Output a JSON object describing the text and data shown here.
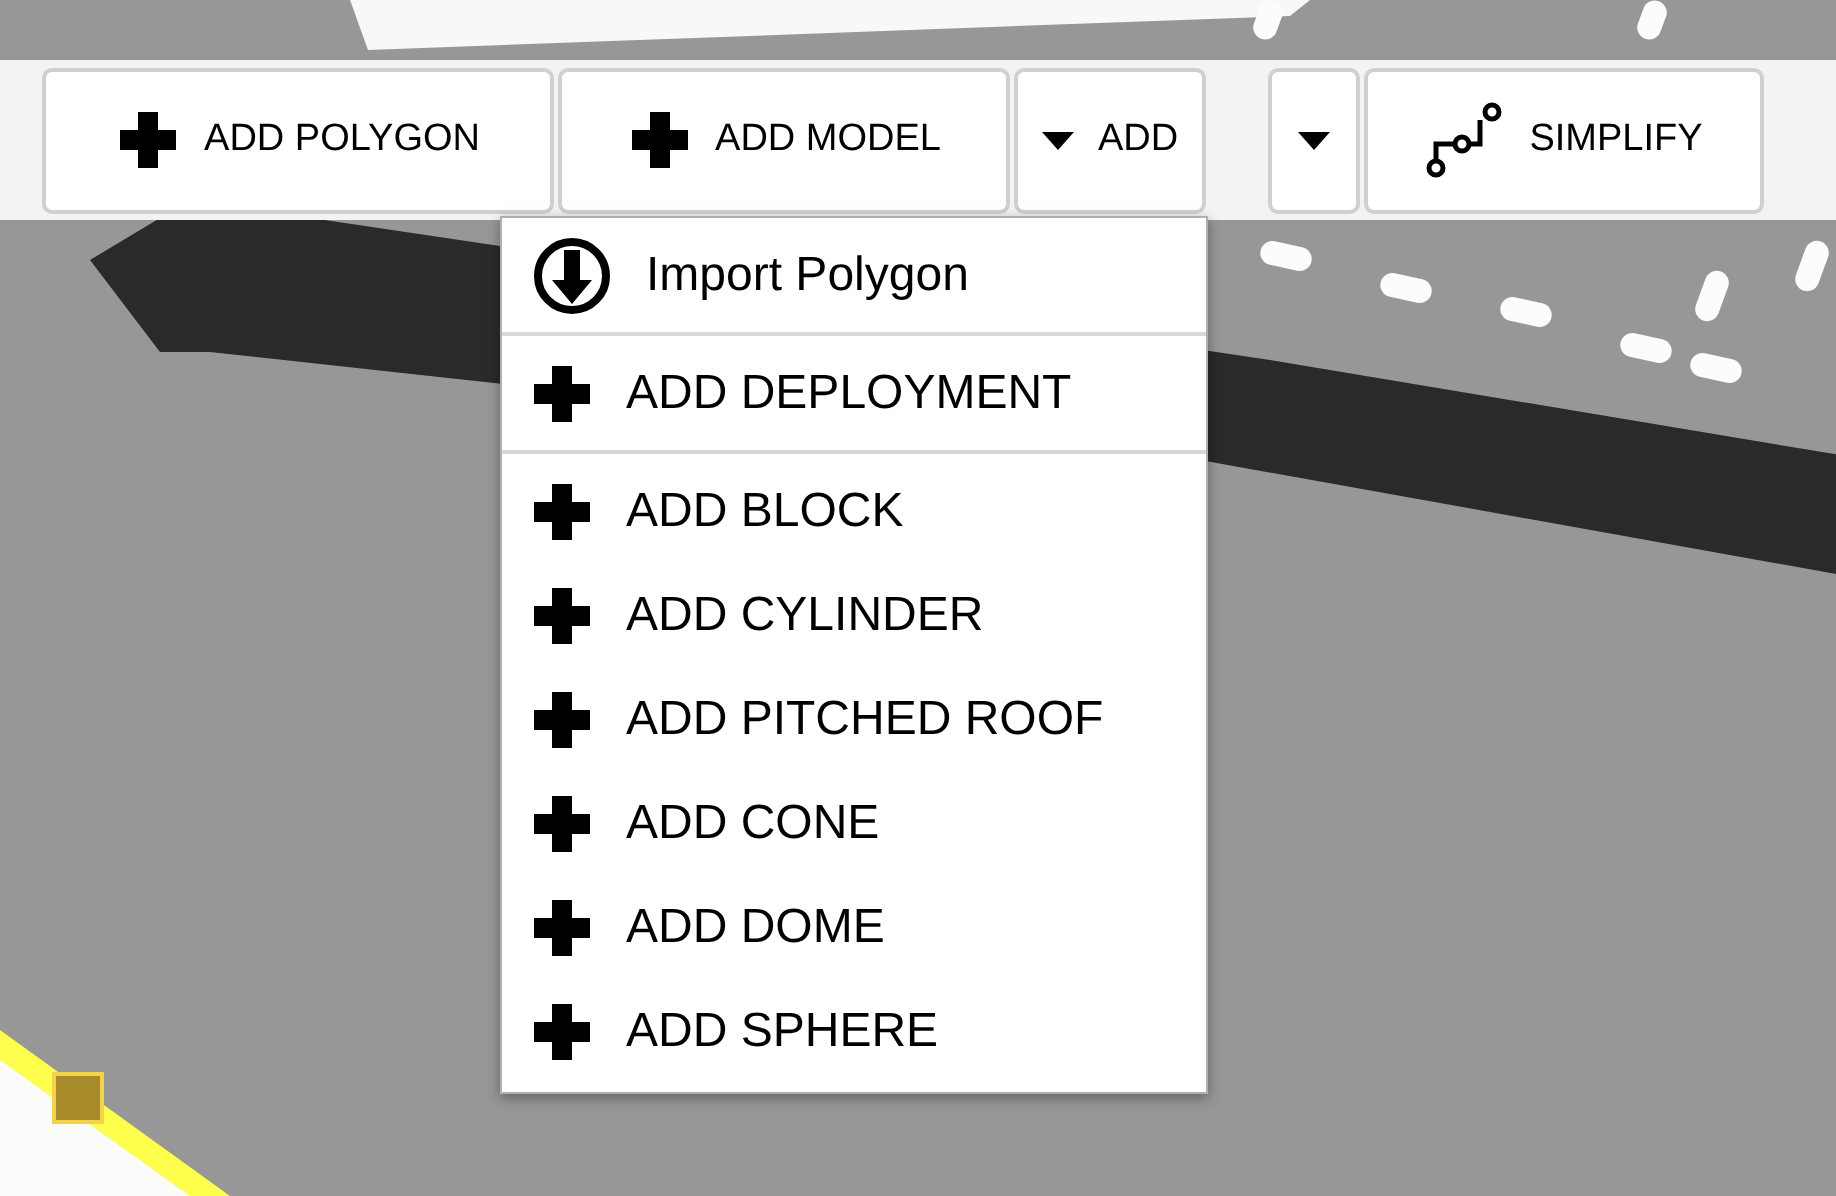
{
  "toolbar": {
    "buttons": [
      {
        "kind": "add",
        "label": "ADD POLYGON"
      },
      {
        "kind": "add",
        "label": "ADD MODEL"
      },
      {
        "kind": "dropdown",
        "label": "ADD"
      },
      {
        "kind": "caret"
      },
      {
        "kind": "simplify",
        "label": "SIMPLIFY"
      }
    ]
  },
  "menu": {
    "sections": [
      [
        {
          "kind": "import",
          "label": "Import Polygon"
        }
      ],
      [
        {
          "kind": "add",
          "label": "ADD DEPLOYMENT"
        }
      ],
      [
        {
          "kind": "add",
          "label": "ADD BLOCK"
        },
        {
          "kind": "add",
          "label": "ADD CYLINDER"
        },
        {
          "kind": "add",
          "label": "ADD PITCHED ROOF"
        },
        {
          "kind": "add",
          "label": "ADD CONE"
        },
        {
          "kind": "add",
          "label": "ADD DOME"
        },
        {
          "kind": "add",
          "label": "ADD SPHERE"
        }
      ]
    ]
  }
}
